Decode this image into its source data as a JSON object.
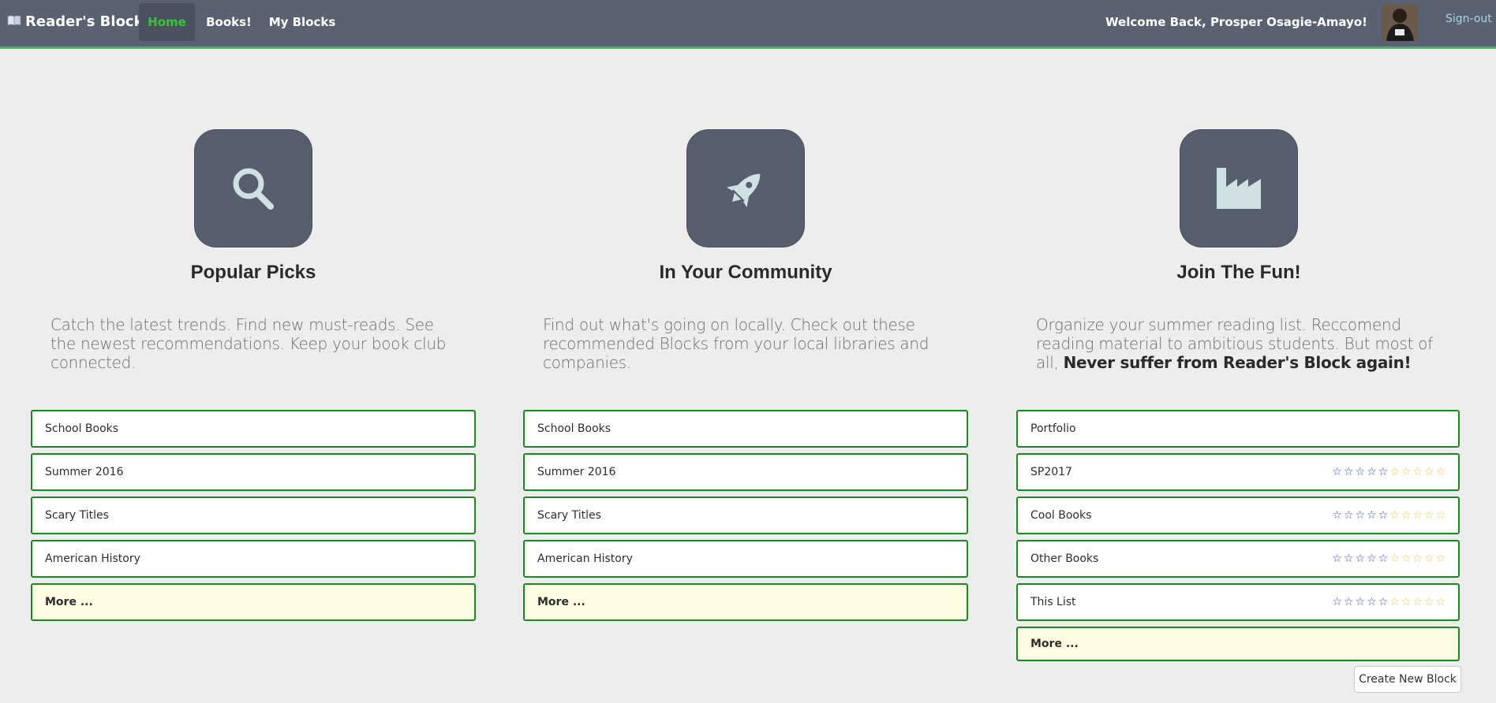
{
  "nav": {
    "brand": "Reader's Block",
    "brand_icon": "open-book-icon",
    "items": [
      {
        "label": "Home",
        "active": true
      },
      {
        "label": "Books!"
      },
      {
        "label": "My Blocks"
      }
    ],
    "welcome": "Welcome Back, Prosper Osagie-Amayo!",
    "signout": "Sign-out",
    "accent": "#34c63a"
  },
  "columns": [
    {
      "icon": "search-icon",
      "title": "Popular Picks",
      "description": "Catch the latest trends. Find new must-reads. See the newest recommendations. Keep your book club connected.",
      "items": [
        {
          "label": "School Books"
        },
        {
          "label": "Summer 2016"
        },
        {
          "label": "Scary Titles"
        },
        {
          "label": "American History"
        }
      ],
      "more": "More ..."
    },
    {
      "icon": "rocket-icon",
      "title": "In Your Community",
      "description": "Find out what's going on locally. Check out these recommended Blocks from your local libraries and companies.",
      "items": [
        {
          "label": "School Books"
        },
        {
          "label": "Summer 2016"
        },
        {
          "label": "Scary Titles"
        },
        {
          "label": "American History"
        }
      ],
      "more": "More ..."
    },
    {
      "icon": "factory-icon",
      "title": "Join The Fun!",
      "description_plain": "Organize your summer reading list. Reccomend reading material to ambitious students. But most of all, ",
      "description_bold": "Never suffer from Reader's Block again!",
      "items": [
        {
          "label": "Portfolio",
          "rating": null
        },
        {
          "label": "SP2017",
          "rating": "0 of 10 stars"
        },
        {
          "label": "Cool Books",
          "rating": "0 of 10 stars"
        },
        {
          "label": "Other Books",
          "rating": "0 of 10 stars"
        },
        {
          "label": "This List",
          "rating": "0 of 10 stars"
        }
      ],
      "more": "More ...",
      "create_button": "Create New Block"
    }
  ],
  "colors": {
    "navbar": "#5a6170",
    "icon_box": "#575e6d",
    "icon_fg": "#cfe1e2",
    "list_border": "#1a8a1f",
    "more_bg": "#fdfde3",
    "star_blue": "#2d52b8",
    "star_yellow": "#f0c238"
  }
}
